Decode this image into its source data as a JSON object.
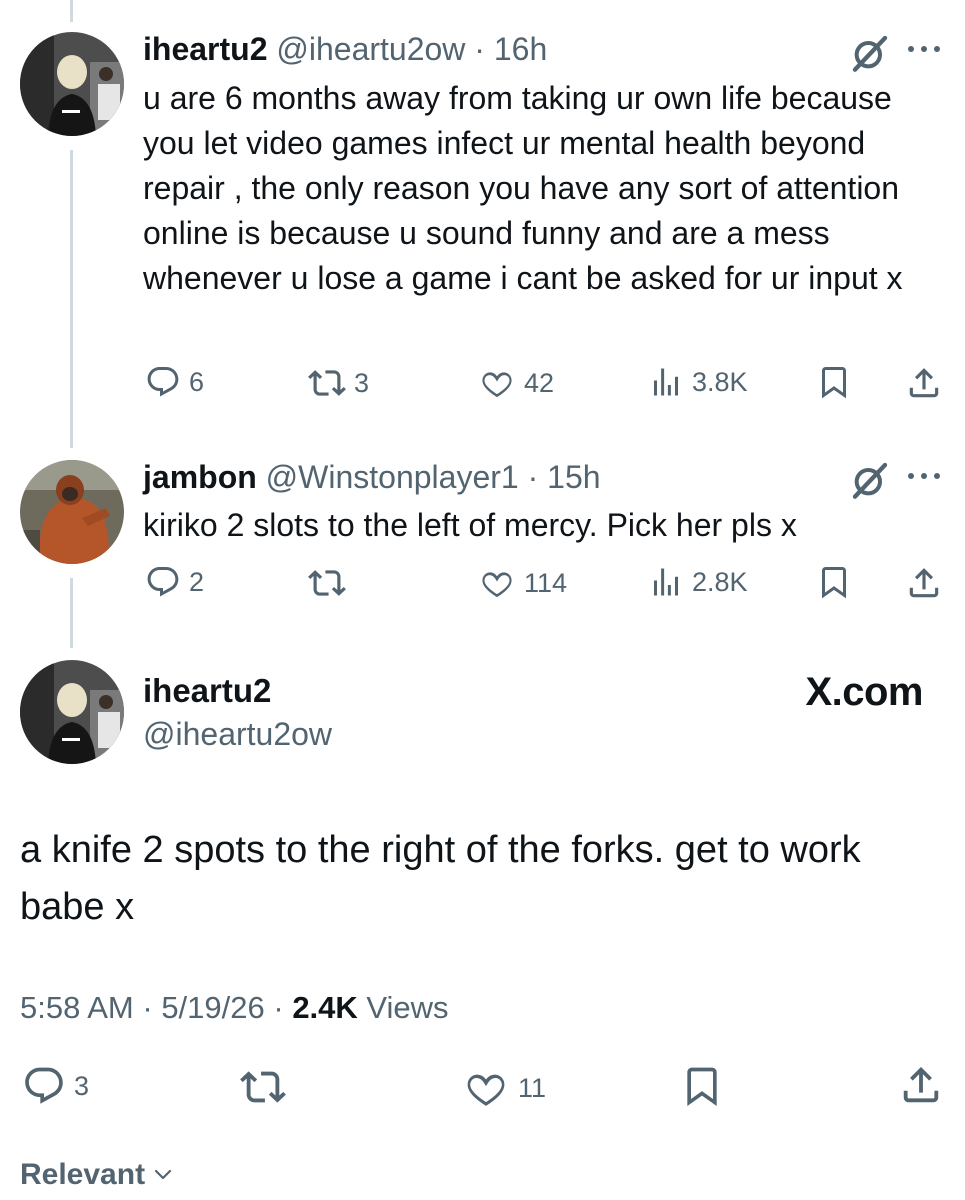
{
  "thread": [
    {
      "name": "iheartu2",
      "handle": "@iheartu2ow",
      "time": "16h",
      "text": "u are 6 months away from taking ur own life because you let video games infect ur mental health beyond repair , the only reason you have any sort of attention online is because u sound funny and are a mess whenever u lose a game i cant be asked for ur input x",
      "replies": "6",
      "reposts": "3",
      "likes": "42",
      "views": "3.8K"
    },
    {
      "name": "jambon",
      "handle": "@Winstonplayer1",
      "time": "15h",
      "text": "kiriko 2 slots to the left of mercy. Pick her pls x",
      "replies": "2",
      "reposts": "",
      "likes": "114",
      "views": "2.8K"
    }
  ],
  "main": {
    "name": "iheartu2",
    "handle": "@iheartu2ow",
    "brand": "X.com",
    "text": "a knife 2 spots to the right of the forks. get to work babe x",
    "time": "5:58 AM",
    "date": "5/19/26",
    "views_count": "2.4K",
    "views_label": "Views",
    "replies": "3",
    "likes": "11"
  },
  "footer": {
    "sort_label": "Relevant"
  },
  "icons": {
    "reply": "reply-icon",
    "repost": "repost-icon",
    "like": "heart-icon",
    "views": "views-icon",
    "bookmark": "bookmark-icon",
    "share": "share-icon",
    "grok": "grok-icon",
    "more": "more-icon"
  },
  "colors": {
    "text": "#0f1419",
    "muted": "#536471",
    "thread_line": "#cfd9de"
  }
}
